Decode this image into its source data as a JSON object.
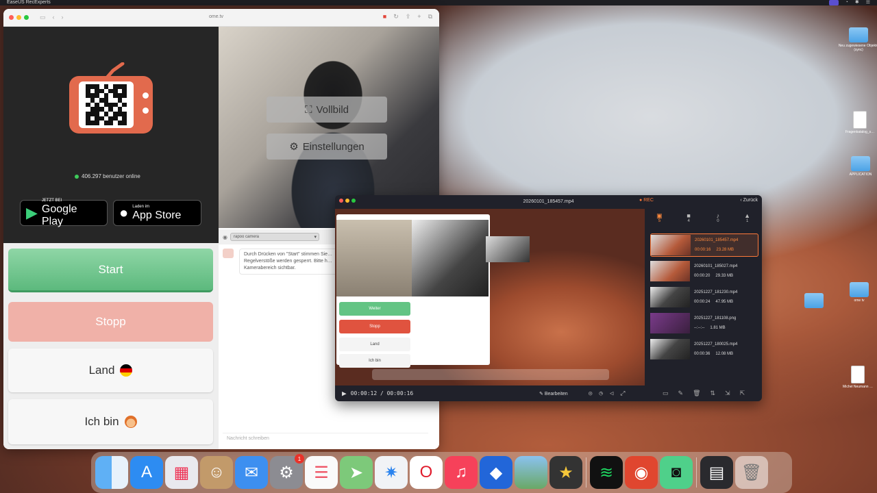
{
  "menubar": {
    "app_name": "EaseUS RecExperts"
  },
  "browser": {
    "url": "ome.tv",
    "online_count": "406.297 benutzer online",
    "google_play": {
      "small": "JETZT BEI",
      "big": "Google Play"
    },
    "app_store": {
      "small": "Laden im",
      "big": "App Store"
    },
    "overlay": {
      "fullscreen": "Vollbild",
      "settings": "Einstellungen"
    },
    "camera_select": "rapoo camera",
    "buttons": {
      "start": "Start",
      "stop": "Stopp",
      "country": "Land",
      "i_am": "Ich bin"
    },
    "chat": {
      "badge": "Ome TV",
      "notice": "Durch Drücken von \"Start\" stimmen Sie… Regelverstöße werden gesperrt. Bitte h… Kamerabereich sichtbar.",
      "input_placeholder": "Nachricht schreiben"
    }
  },
  "recorder": {
    "title": "20260101_185457.mp4",
    "rec_label": "REC",
    "back_label": "Zurück",
    "tabs": [
      {
        "icon": "folder-icon",
        "count": "5"
      },
      {
        "icon": "video-icon",
        "count": "4"
      },
      {
        "icon": "audio-icon",
        "count": "0"
      },
      {
        "icon": "image-icon",
        "count": "1"
      }
    ],
    "mini_buttons": {
      "next": "Weiter",
      "stop": "Stopp",
      "country": "Land",
      "i_am": "Ich bin"
    },
    "time_display": "00:00:12 / 00:00:16",
    "edit_label": "Bearbeiten",
    "recordings": [
      {
        "name": "20260101_185457.mp4",
        "duration": "00:00:16",
        "size": "23.28 MB",
        "selected": true
      },
      {
        "name": "20260101_185027.mp4",
        "duration": "00:00:20",
        "size": "29.33 MB",
        "selected": false
      },
      {
        "name": "20251227_181230.mp4",
        "duration": "00:00:24",
        "size": "47.95 MB",
        "selected": false
      },
      {
        "name": "20251227_181108.png",
        "duration": "--:--:--",
        "size": "1.81 MB",
        "selected": false
      },
      {
        "name": "20251227_180025.mp4",
        "duration": "00:00:36",
        "size": "12.08 MB",
        "selected": false
      }
    ]
  },
  "desktop_icons": [
    {
      "label": "Neu zugewiesene Objekte (sync)",
      "type": "folder"
    },
    {
      "label": "Fragenkatalog_s…",
      "type": "doc"
    },
    {
      "label": "APPLICATION",
      "type": "folder"
    },
    {
      "label": "ome tv",
      "type": "folder"
    },
    {
      "label": "Michel Neumann …",
      "type": "doc"
    }
  ],
  "dock": {
    "settings_badge": "1",
    "apps": [
      "finder",
      "app-store",
      "launchpad",
      "contacts",
      "mail",
      "system-settings",
      "reminders",
      "maps",
      "safari",
      "opera",
      "music",
      "roblox",
      "preview",
      "imovie",
      "spotify",
      "recexperts",
      "whatsapp",
      "screenshot",
      "trash"
    ]
  }
}
